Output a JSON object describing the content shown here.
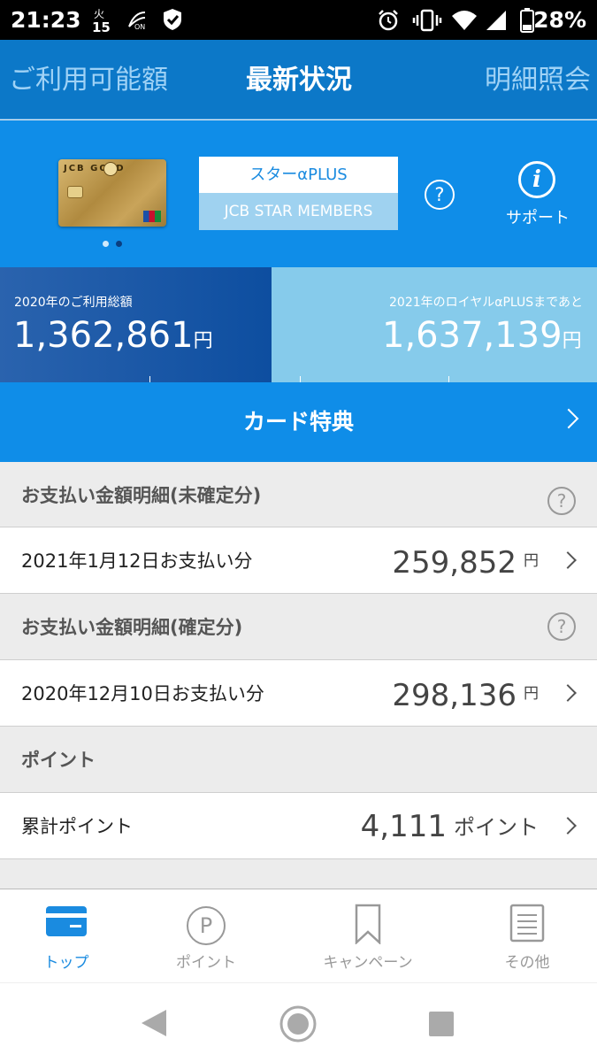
{
  "status_bar": {
    "time": "21:23",
    "date_icon_text": "火\n15",
    "battery_percent": "28%"
  },
  "tabs": [
    {
      "label": "ご利用可能額",
      "active": false
    },
    {
      "label": "最新状況",
      "active": true
    },
    {
      "label": "明細照会",
      "active": false
    }
  ],
  "hero": {
    "card_brand": "JCB GOLD",
    "status_top": "スターαPLUS",
    "status_bottom": "JCB STAR MEMBERS",
    "help_symbol": "?",
    "support_label": "サポート",
    "support_symbol": "i"
  },
  "usage": {
    "left_label": "2020年のご利用総額",
    "left_value": "1,362,861",
    "right_label": "2021年のロイヤルαPLUSまであと",
    "right_value": "1,637,139",
    "unit": "円"
  },
  "benefit": {
    "label": "カード特典"
  },
  "sections": {
    "unconfirmed": {
      "title": "お支払い金額明細(未確定分)",
      "row_label": "2021年1月12日お支払い分",
      "row_value": "259,852",
      "row_unit": "円"
    },
    "confirmed": {
      "title": "お支払い金額明細(確定分)",
      "row_label": "2020年12月10日お支払い分",
      "row_value": "298,136",
      "row_unit": "円"
    },
    "points": {
      "title": "ポイント",
      "row_label": "累計ポイント",
      "row_value": "4,111",
      "row_unit": "ポイント"
    }
  },
  "bottom_nav": [
    {
      "label": "トップ",
      "icon": "card-icon",
      "active": true
    },
    {
      "label": "ポイント",
      "icon": "point-icon",
      "active": false
    },
    {
      "label": "キャンペーン",
      "icon": "bookmark-icon",
      "active": false
    },
    {
      "label": "その他",
      "icon": "list-icon",
      "active": false
    }
  ],
  "colors": {
    "tab_bar": "#0c78c8",
    "hero": "#0f8de8",
    "usage_left": "#0d4ea0",
    "usage_right": "#86cbeb",
    "accent": "#1a8be0"
  }
}
